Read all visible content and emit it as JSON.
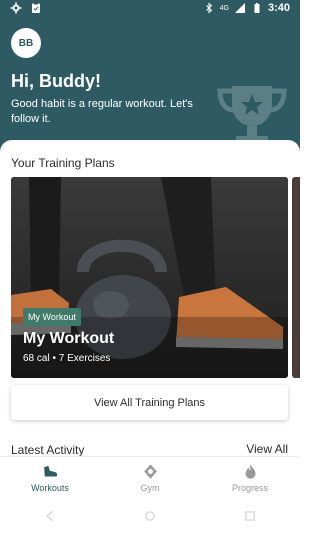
{
  "status_bar": {
    "time": "3:40",
    "network": "4G",
    "left_icons": [
      "gear-icon",
      "clipboard-icon"
    ],
    "right_icons": [
      "bluetooth-icon",
      "signal-icon",
      "battery-icon"
    ]
  },
  "header": {
    "avatar_initials": "BB",
    "greeting": "Hi, Buddy!",
    "subtitle": "Good habit is a regular workout. Let's follow it.",
    "decor_icon": "trophy-icon",
    "background_color": "#2e5a63"
  },
  "training_plans": {
    "title": "Your Training Plans",
    "cards": [
      {
        "tag": "My Workout",
        "name": "My Workout",
        "meta": "68 cal • 7 Exercises",
        "tag_color": "#3f7a6b"
      }
    ],
    "view_all_label": "View All Training Plans"
  },
  "latest_activity": {
    "title": "Latest Activity",
    "view_all_label": "View All"
  },
  "bottom_nav": {
    "items": [
      {
        "label": "Workouts",
        "icon": "shoe-icon",
        "active": true
      },
      {
        "label": "Gym",
        "icon": "gym-icon",
        "active": false
      },
      {
        "label": "Progress",
        "icon": "flame-icon",
        "active": false
      }
    ],
    "active_color": "#2e5a63",
    "inactive_color": "#9a9a9a"
  },
  "system_nav": [
    "back-icon",
    "home-icon",
    "recents-icon"
  ]
}
